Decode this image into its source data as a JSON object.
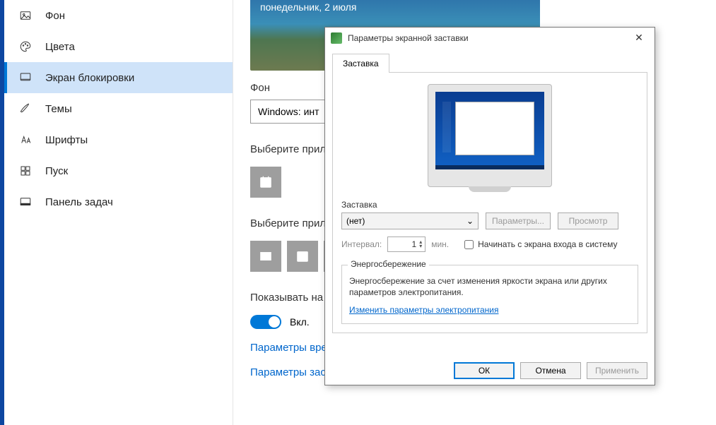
{
  "sidebar": {
    "items": [
      {
        "label": "Фон"
      },
      {
        "label": "Цвета"
      },
      {
        "label": "Экран блокировки"
      },
      {
        "label": "Темы"
      },
      {
        "label": "Шрифты"
      },
      {
        "label": "Пуск"
      },
      {
        "label": "Панель задач"
      }
    ]
  },
  "main": {
    "preview_date": "понедельник, 2 июля",
    "bg_label": "Фон",
    "bg_value": "Windows: инт",
    "pick_app_detail": "Выберите приложение для вывода подробные све",
    "pick_app_status": "Выберите прило будут отобража",
    "show_fun": "Показывать на э блокировки",
    "toggle_label": "Вкл.",
    "link_time": "Параметры вре",
    "link_saver": "Параметры заставки"
  },
  "dialog": {
    "title": "Параметры экранной заставки",
    "tab": "Заставка",
    "group": "Заставка",
    "select_value": "(нет)",
    "btn_params": "Параметры...",
    "btn_preview": "Просмотр",
    "interval_label": "Интервал:",
    "interval_value": "1",
    "interval_unit": "мин.",
    "cb_label": "Начинать с экрана входа в систему",
    "energy": {
      "legend": "Энергосбережение",
      "desc": "Энергосбережение за счет изменения яркости экрана или других параметров электропитания.",
      "link": "Изменить параметры электропитания"
    },
    "ok": "ОК",
    "cancel": "Отмена",
    "apply": "Применить"
  }
}
